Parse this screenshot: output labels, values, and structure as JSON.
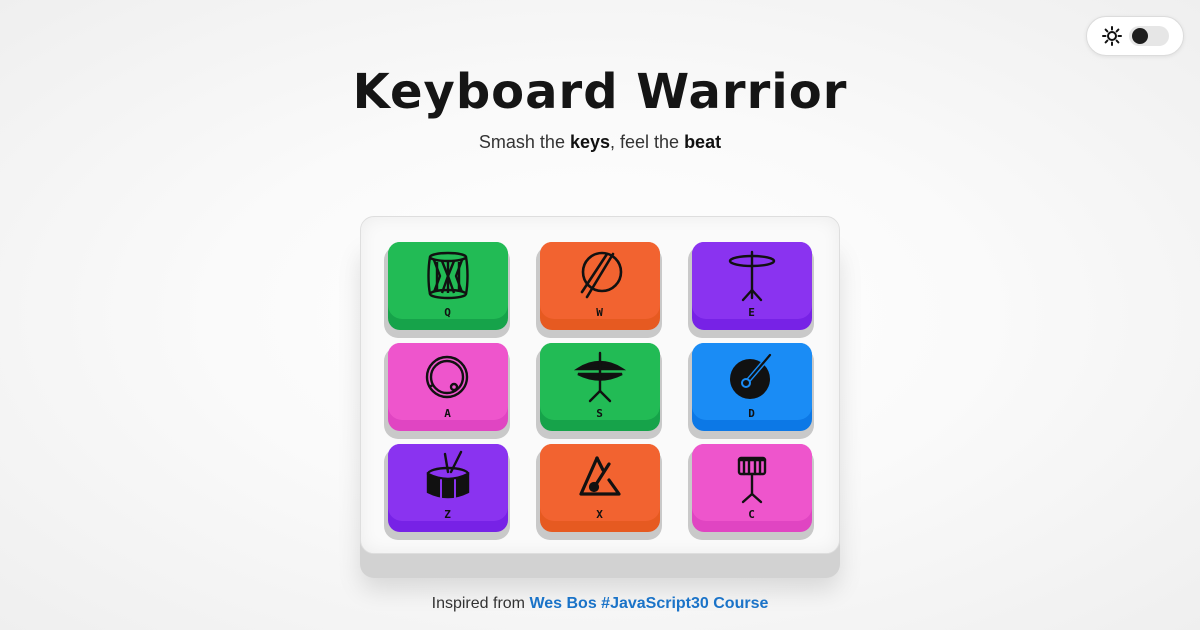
{
  "header": {
    "title": "Keyboard Warrior",
    "subtitle_1": "Smash the ",
    "subtitle_keys": "keys",
    "subtitle_2": ", feel the ",
    "subtitle_beat": "beat"
  },
  "theme_toggle": {
    "icon": "sun-icon",
    "state": "light"
  },
  "pads": [
    {
      "key": "Q",
      "icon": "dhol-drum-icon",
      "color": "#22bb55"
    },
    {
      "key": "W",
      "icon": "drum-sticks-icon",
      "color": "#f26330"
    },
    {
      "key": "E",
      "icon": "cymbal-stand-icon",
      "color": "#8a33f0"
    },
    {
      "key": "A",
      "icon": "bass-drum-icon",
      "color": "#ee55cc"
    },
    {
      "key": "S",
      "icon": "hihat-icon",
      "color": "#22bb55"
    },
    {
      "key": "D",
      "icon": "tom-drum-icon",
      "color": "#1a8cf5"
    },
    {
      "key": "Z",
      "icon": "snare-drum-icon",
      "color": "#8a33f0"
    },
    {
      "key": "X",
      "icon": "triangle-icon",
      "color": "#f26330"
    },
    {
      "key": "C",
      "icon": "snare-stand-icon",
      "color": "#ee55cc"
    }
  ],
  "footer": {
    "prefix": "Inspired from ",
    "link_text": "Wes Bos #JavaScript30 Course"
  }
}
